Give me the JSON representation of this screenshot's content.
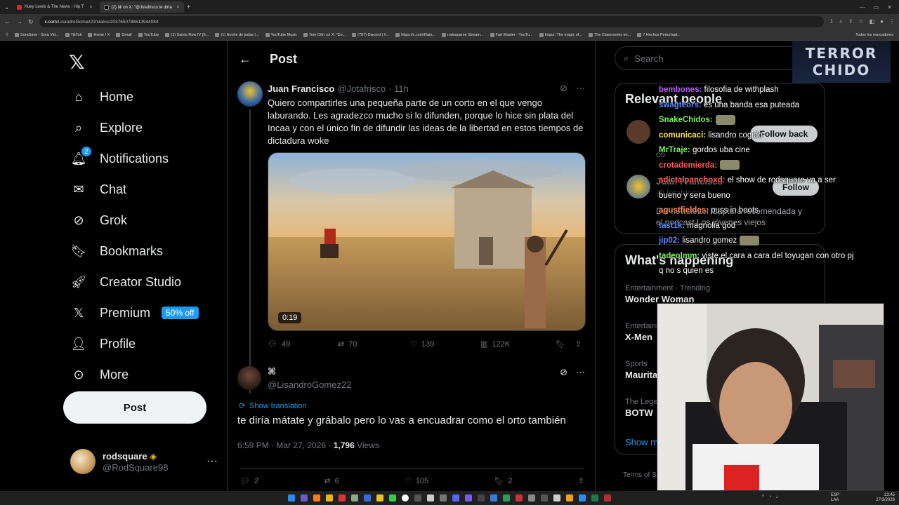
{
  "browser": {
    "tabs": [
      {
        "label": "Huey Lewis & The News - Hip T",
        "active": false
      },
      {
        "label": "(2) ⌘ on X: \"@Jotafrisco te diría",
        "active": true
      }
    ],
    "url_prefix": "x.com",
    "url_path": "/LisandroGomez22/status/2037650788613944084",
    "bookmarks": [
      "SoraSave - Sora Vid...",
      "TikTok",
      "Home / X",
      "Gmail",
      "YouTube",
      "(1) Saints Row IV [S...",
      "(1) Noche de jodas t...",
      "YouTube Music",
      "Tom Dőrr on X: \"Co...",
      "(787) Discord | #...",
      "https://x.com/Rain...",
      "rodsquaree Stream...",
      "Fart Master - YouTu...",
      "Imgur: The magic of...",
      "The Classrooms en...",
      "7 Hechos Perturbad..."
    ],
    "bookmarks_all": "Todos los marcadores"
  },
  "nav": {
    "logo": "𝕏",
    "items": [
      {
        "label": "Home",
        "icon": "home-icon"
      },
      {
        "label": "Explore",
        "icon": "search-icon"
      },
      {
        "label": "Notifications",
        "icon": "bell-icon",
        "badge": "2"
      },
      {
        "label": "Chat",
        "icon": "mail-icon"
      },
      {
        "label": "Grok",
        "icon": "grok-icon"
      },
      {
        "label": "Bookmarks",
        "icon": "bookmark-icon"
      },
      {
        "label": "Creator Studio",
        "icon": "rocket-icon"
      },
      {
        "label": "Premium",
        "icon": "x-premium-icon",
        "pill": "50% off"
      },
      {
        "label": "Profile",
        "icon": "person-icon"
      },
      {
        "label": "More",
        "icon": "more-circle-icon"
      }
    ],
    "post_button": "Post",
    "account": {
      "name": "rodsquare",
      "handle": "@RodSquare98"
    }
  },
  "main": {
    "header_title": "Post",
    "tweet": {
      "name": "Juan Francisco",
      "handle": "@Jotafrisco",
      "time": "· 11h",
      "text": "Quiero compartirles una pequeña parte de un corto en el que vengo laburando. Les agradezco mucho si lo difunden, porque lo hice sin plata del Incaa y con el único fin de difundir las ideas de la libertad en estos tiempos de dictadura woke",
      "video_duration": "0:19",
      "replies": "49",
      "reposts": "70",
      "likes": "139",
      "views": "122K"
    },
    "reply": {
      "name": "⌘",
      "handle": "@LisandroGomez22",
      "show_translation": "Show translation",
      "text": "te diría mátate y grábalo pero lo vas a encuadrar como el orto también",
      "timestamp": "6:59 PM · Mar 27, 2026 · ",
      "views_count": "1,796",
      "views_label": " Views",
      "replies": "2",
      "reposts": "6",
      "likes": "105",
      "bookmarks": "2"
    }
  },
  "right": {
    "search_placeholder": "Search",
    "relevant_title": "Relevant people",
    "relevant_people_fragment": "co",
    "follow_back": "Follow back",
    "follow": "Follow",
    "person2_name": "Juan Francisco",
    "person2_handle": "@Jotafrisco",
    "person2_bio_1": "Del newsletter Captura recomendada y",
    "person2_bio_2": "el podcast Los jóvenes viejos",
    "whats_title": "What's happening",
    "trends": [
      {
        "kicker": "Entertainment · Trending",
        "title": "Wonder Woman"
      },
      {
        "kicker": "Entertainment",
        "title": "X-Men"
      },
      {
        "kicker": "Sports",
        "title": "Mauritania"
      },
      {
        "kicker": "The Legend",
        "title": "BOTW"
      }
    ],
    "show_more": "Show more",
    "terms": "Terms of S"
  },
  "stream": {
    "logo_line1": "TERROR",
    "logo_line2": "CHIDO",
    "chat": [
      {
        "user": "bembones:",
        "msg": " filosofia de withplash",
        "color": "#c05aff"
      },
      {
        "user": "swagteors:",
        "msg": " es una banda esa puteada",
        "color": "#5a8cff"
      },
      {
        "user": "SnakeChidos:",
        "msg": "",
        "color": "#7cf25a",
        "emote": true
      },
      {
        "user": "comunicaci:",
        "msg": " lisandro cogido",
        "color": "#ffe15a"
      },
      {
        "user": "MrTraje:",
        "msg": " gordos uba cine",
        "color": "#7cf25a"
      },
      {
        "user": "crotademierda:",
        "msg": "",
        "color": "#ff5a5a",
        "emote": true
      },
      {
        "user": "adictalpanchoxd:",
        "msg": " el show de rodsquare va a ser bueno y sera bueno",
        "color": "#ff5a5a"
      },
      {
        "user": "agustfieldes:",
        "msg": " puss in boots",
        "color": "#ff8a5a"
      },
      {
        "user": "tast1k:",
        "msg": " magnolia god",
        "color": "#5a8cff"
      },
      {
        "user": "jip02:",
        "msg": " lisandro gomez",
        "color": "#5a8cff",
        "emote": true
      },
      {
        "user": "tadeolmm:",
        "msg": " viste el cara a cara del toyugan con otro pj q no s quien es",
        "color": "#7cf25a"
      }
    ]
  },
  "taskbar": {
    "lang": "ESP",
    "lang2": "LAA",
    "time": "23:45",
    "date": "27/3/2026"
  },
  "colors": {
    "accent": "#1d9bf0",
    "bg": "#000000",
    "border": "#2f3336",
    "muted": "#71767b"
  }
}
